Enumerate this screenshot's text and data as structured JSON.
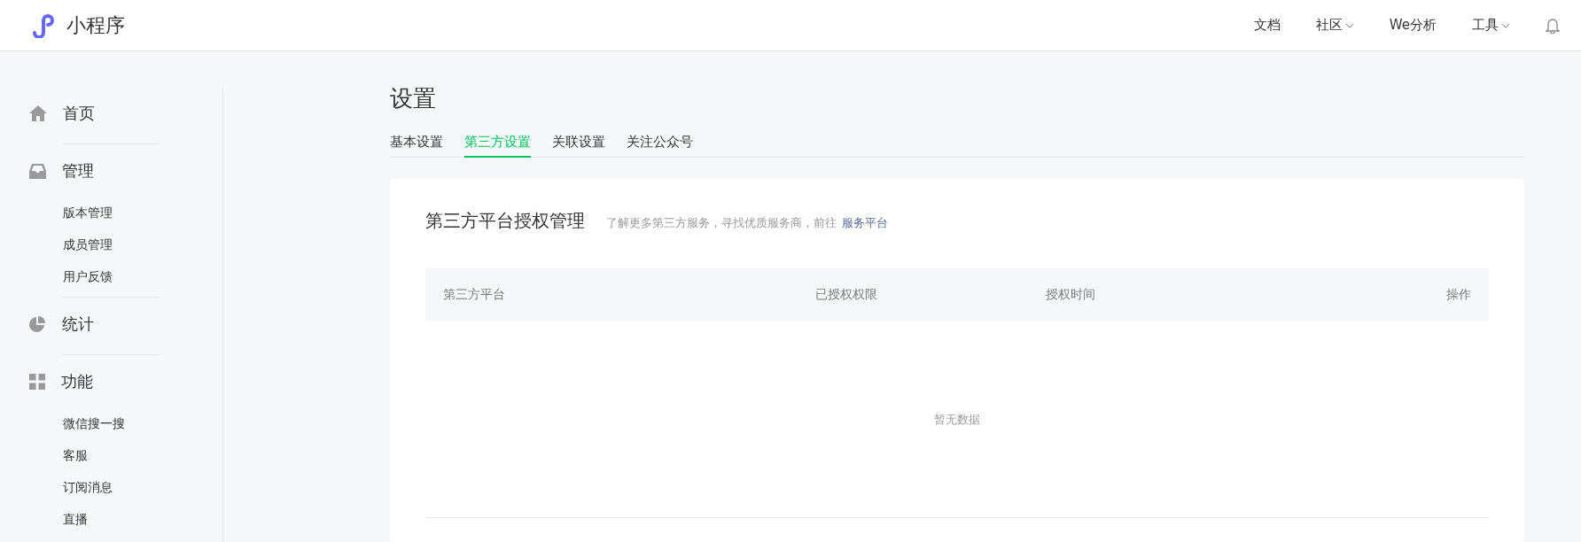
{
  "header": {
    "brand": "小程序",
    "nav": [
      {
        "label": "文档",
        "dropdown": false
      },
      {
        "label": "社区",
        "dropdown": true
      },
      {
        "label": "We分析",
        "dropdown": false
      },
      {
        "label": "工具",
        "dropdown": true
      }
    ]
  },
  "sidebar": {
    "sections": [
      {
        "label": "首页"
      },
      {
        "label": "管理",
        "children": [
          "版本管理",
          "成员管理",
          "用户反馈"
        ]
      },
      {
        "label": "统计"
      },
      {
        "label": "功能",
        "children": [
          "微信搜一搜",
          "客服",
          "订阅消息",
          "直播"
        ]
      }
    ]
  },
  "page": {
    "title": "设置",
    "tabs": [
      {
        "label": "基本设置",
        "selected": false
      },
      {
        "label": "第三方设置",
        "selected": true
      },
      {
        "label": "关联设置",
        "selected": false
      },
      {
        "label": "关注公众号",
        "selected": false
      }
    ]
  },
  "card": {
    "title": "第三方平台授权管理",
    "hint": "了解更多第三方服务，寻找优质服务商，前往",
    "link": "服务平台",
    "table": {
      "columns": [
        "第三方平台",
        "已授权权限",
        "授权时间",
        "操作"
      ],
      "empty": "暂无数据"
    }
  }
}
